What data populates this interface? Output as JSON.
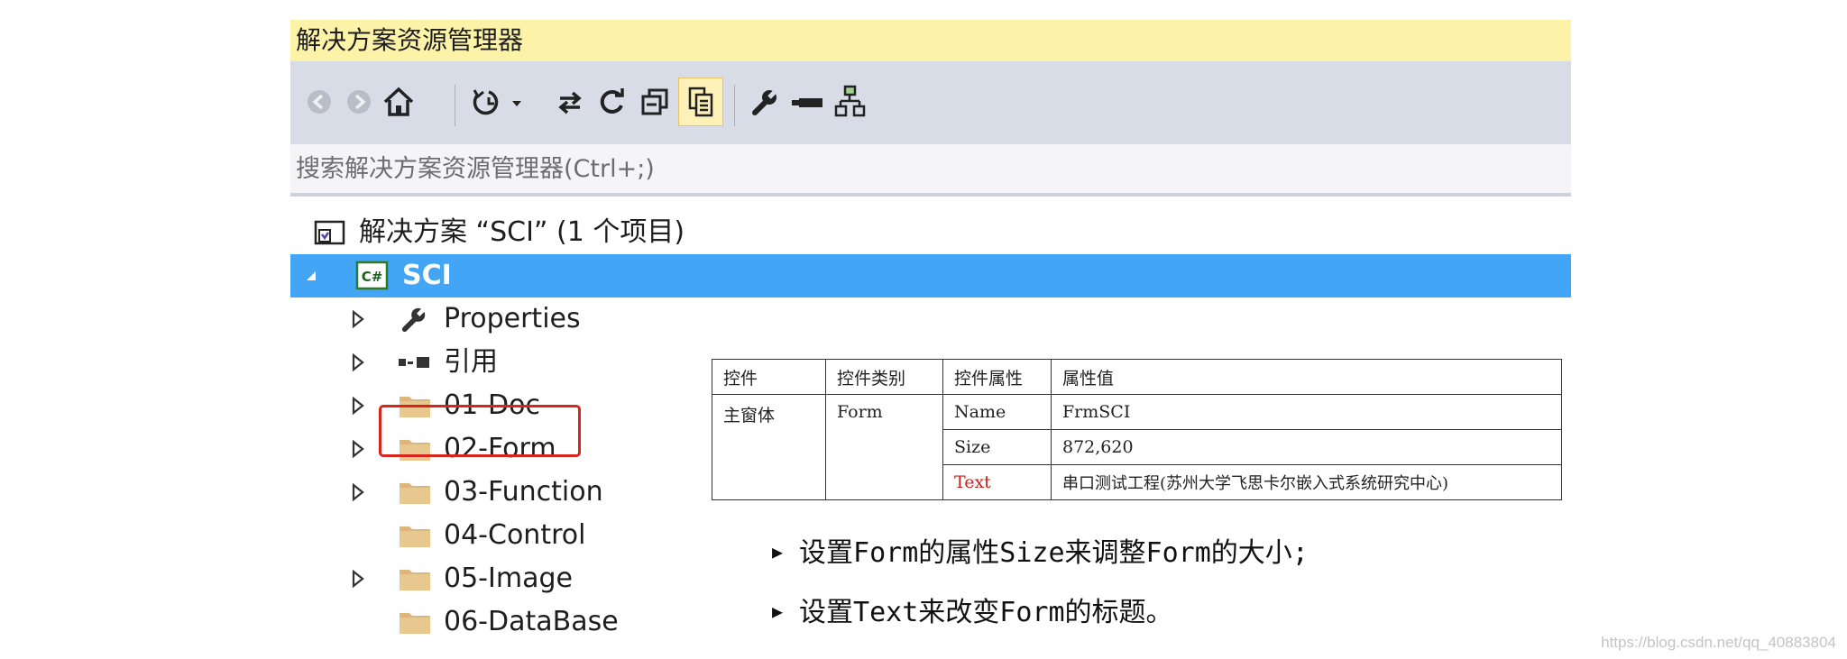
{
  "window": {
    "title": "解决方案资源管理器"
  },
  "toolbar": {
    "buttons": [
      {
        "name": "back",
        "icon": "back-arrow-icon"
      },
      {
        "name": "forward",
        "icon": "forward-arrow-icon"
      },
      {
        "name": "home",
        "icon": "home-icon"
      },
      {
        "name": "pending-changes",
        "icon": "history-clock-icon"
      },
      {
        "name": "sync",
        "icon": "sync-arrows-icon"
      },
      {
        "name": "refresh",
        "icon": "refresh-icon"
      },
      {
        "name": "collapse-all",
        "icon": "collapse-all-icon"
      },
      {
        "name": "show-all-files",
        "icon": "show-all-files-icon",
        "active": true
      },
      {
        "name": "properties",
        "icon": "wrench-icon"
      },
      {
        "name": "preview",
        "icon": "minus-icon"
      },
      {
        "name": "view-class-diagram",
        "icon": "class-diagram-icon"
      }
    ]
  },
  "search": {
    "placeholder": "搜索解决方案资源管理器(Ctrl+;)"
  },
  "tree": {
    "solution": "解决方案 “SCI” (1 个项目)",
    "project": "SCI",
    "project_badge": "C#",
    "items": [
      {
        "label": "Properties",
        "icon": "wrench-icon",
        "expandable": true
      },
      {
        "label": "引用",
        "icon": "references-icon",
        "expandable": true
      },
      {
        "label": "01-Doc",
        "icon": "folder-icon",
        "expandable": true
      },
      {
        "label": "02-Form",
        "icon": "folder-icon",
        "expandable": true,
        "highlighted": true
      },
      {
        "label": "03-Function",
        "icon": "folder-icon",
        "expandable": true
      },
      {
        "label": "04-Control",
        "icon": "folder-icon",
        "expandable": false
      },
      {
        "label": "05-Image",
        "icon": "folder-icon",
        "expandable": true
      },
      {
        "label": "06-DataBase",
        "icon": "folder-icon",
        "expandable": false
      }
    ]
  },
  "table": {
    "headers": [
      "控件",
      "控件类别",
      "控件属性",
      "属性值"
    ],
    "control": "主窗体",
    "category": "Form",
    "rows": [
      {
        "property": "Name",
        "value": "FrmSCI"
      },
      {
        "property": "Size",
        "value": "872,620"
      },
      {
        "property": "Text",
        "value": "串口测试工程(苏州大学飞思卡尔嵌入式系统研究中心)",
        "highlight_color": "#c8201a"
      }
    ]
  },
  "notes": [
    "设置Form的属性Size来调整Form的大小;",
    "设置Text来改变Form的标题。"
  ],
  "watermark": "https://blog.csdn.net/qq_40883804",
  "colors": {
    "title_bg": "#fdf3a8",
    "selection": "#42a5f5",
    "highlight_box": "#d9241e",
    "toolbar_bg": "#d8dce6"
  }
}
